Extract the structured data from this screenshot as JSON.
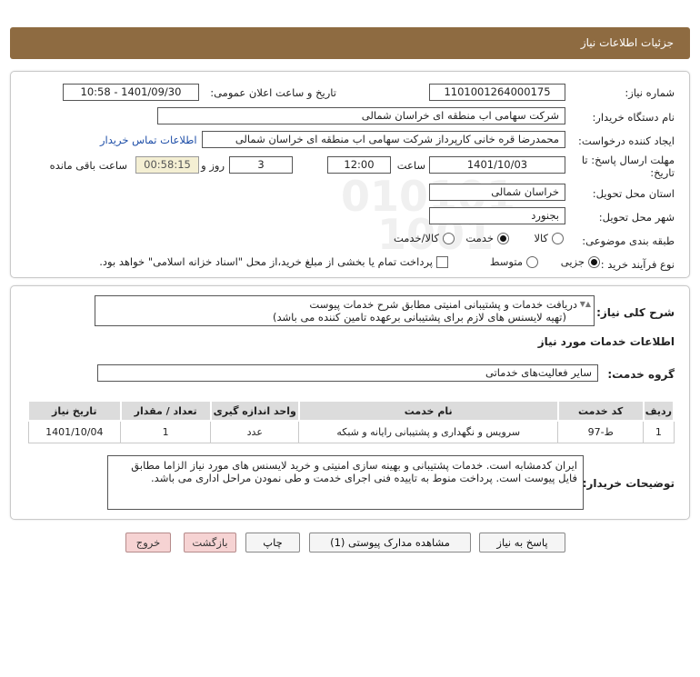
{
  "header": {
    "title": "جزئیات اطلاعات نیاز"
  },
  "form": {
    "need_number_label": "شماره نیاز:",
    "need_number": "1101001264000175",
    "announce_label": "تاریخ و ساعت اعلان عمومی:",
    "announce_value": "1401/09/30 - 10:58",
    "buyer_org_label": "نام دستگاه خریدار:",
    "buyer_org": "شرکت سهامی اب منطقه ای خراسان شمالی",
    "requester_label": "ایجاد کننده درخواست:",
    "requester": "محمدرضا قره خانی کارپرداز شرکت سهامی اب منطقه ای خراسان شمالی",
    "contact_link": "اطلاعات تماس خریدار",
    "deadline_label_1": "مهلت ارسال پاسخ: تا",
    "deadline_label_2": "تاریخ:",
    "deadline_date": "1401/10/03",
    "time_label": "ساعت",
    "deadline_time": "12:00",
    "days_value": "3",
    "days_label": "روز و",
    "remaining_time": "00:58:15",
    "remaining_label": "ساعت باقی مانده",
    "province_label": "استان محل تحویل:",
    "province": "خراسان شمالی",
    "city_label": "شهر محل تحویل:",
    "city": "بجنورد",
    "category_label": "طبقه بندی موضوعی:",
    "category_options": [
      "کالا",
      "خدمت",
      "کالا/خدمت"
    ],
    "category_selected": "خدمت",
    "process_label": "نوع فرآیند خرید :",
    "process_options": [
      "جزیی",
      "متوسط"
    ],
    "process_selected": "جزیی",
    "payment_note": "پرداخت تمام یا بخشی از مبلغ خرید،از محل \"اسناد خزانه اسلامی\" خواهد بود."
  },
  "need": {
    "summary_label": "شرح کلی نیاز:",
    "summary_line1": "دریافت خدمات و پشتیبانی امنیتی مطابق شرح خدمات پیوست",
    "summary_line2": "(تهیه لایسنس های لازم برای پشتیبانی برعهده تامین کننده می باشد)",
    "services_heading": "اطلاعات خدمات مورد نیاز",
    "service_group_label": "گروه خدمت:",
    "service_group": "سایر فعالیت‌های خدماتی"
  },
  "table": {
    "headers": [
      "ردیف",
      "کد خدمت",
      "نام خدمت",
      "واحد اندازه گیری",
      "تعداد / مقدار",
      "تاریخ نیاز"
    ],
    "rows": [
      [
        "1",
        "ط-97",
        "سرویس و نگهداری و پشتیبانی رایانه و شبکه",
        "عدد",
        "1",
        "1401/10/04"
      ]
    ]
  },
  "buyer_notes": {
    "label": "توضیحات خریدار:",
    "text": "ایران کدمشابه است. خدمات پشتیبانی و بهینه سازی امنیتی و خرید لایسنس های مورد نیاز الزاما مطابق فایل پیوست است. پرداخت منوط به تاییده فنی اجرای خدمت و طی نمودن مراحل اداری می باشد."
  },
  "buttons": {
    "reply": "پاسخ به نیاز",
    "attachments": "مشاهده مدارک پیوستی (1)",
    "print": "چاپ",
    "back": "بازگشت",
    "exit": "خروج"
  },
  "watermark": {
    "digits_1": "010101",
    "digits_2": "1001",
    "brand": "ParsNamadData",
    "fa_line1": "مرکز فراهم آوری اطلاعات مناقصه ها",
    "fa_line2": "پایگاه اطلاع رسانی مناقصه ومزایده"
  }
}
